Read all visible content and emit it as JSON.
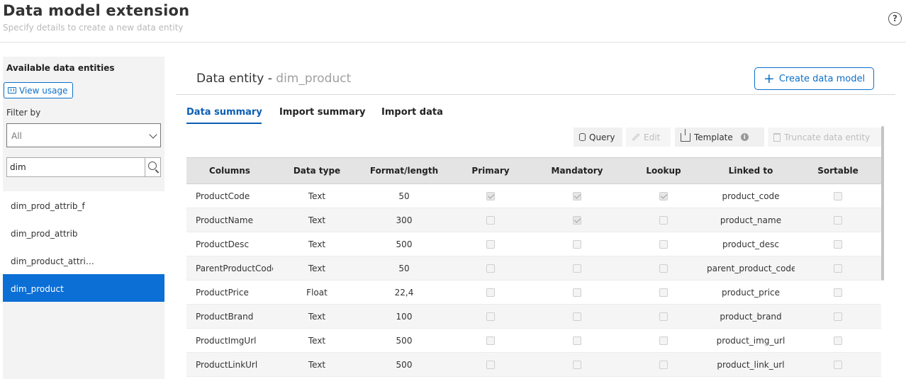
{
  "header": {
    "title": "Data model extension",
    "subtitle": "Specify details to create a new data entity",
    "help_glyph": "?"
  },
  "sidebar": {
    "title": "Available data entities",
    "view_usage_label": "View usage",
    "filter_label": "Filter by",
    "filter_value": "All",
    "search_value": "dim",
    "items": [
      {
        "label": "dim_prod_attrib_f",
        "active": false
      },
      {
        "label": "dim_prod_attrib",
        "active": false
      },
      {
        "label": "dim_product_attri…",
        "active": false
      },
      {
        "label": "dim_product",
        "active": true
      }
    ]
  },
  "main": {
    "heading_prefix": "Data entity - ",
    "entity_name": "dim_product",
    "create_button_label": "Create data model",
    "tabs": [
      {
        "label": "Data summary",
        "active": true
      },
      {
        "label": "Import summary",
        "active": false
      },
      {
        "label": "Import data",
        "active": false
      }
    ],
    "toolbar": {
      "query_label": "Query",
      "edit_label": "Edit",
      "template_label": "Template",
      "truncate_label": "Truncate data entity",
      "info_glyph": "i"
    },
    "table": {
      "columns": [
        "Columns",
        "Data type",
        "Format/length",
        "Primary",
        "Mandatory",
        "Lookup",
        "Linked to",
        "Sortable"
      ],
      "rows": [
        {
          "column": "ProductCode",
          "type": "Text",
          "format": "50",
          "primary": true,
          "mandatory": true,
          "lookup": true,
          "linked_to": "product_code",
          "sortable": false
        },
        {
          "column": "ProductName",
          "type": "Text",
          "format": "300",
          "primary": false,
          "mandatory": true,
          "lookup": false,
          "linked_to": "product_name",
          "sortable": false
        },
        {
          "column": "ProductDesc",
          "type": "Text",
          "format": "500",
          "primary": false,
          "mandatory": false,
          "lookup": false,
          "linked_to": "product_desc",
          "sortable": false
        },
        {
          "column": "ParentProductCode",
          "type": "Text",
          "format": "50",
          "primary": false,
          "mandatory": false,
          "lookup": false,
          "linked_to": "parent_product_code",
          "sortable": false
        },
        {
          "column": "ProductPrice",
          "type": "Float",
          "format": "22,4",
          "primary": false,
          "mandatory": false,
          "lookup": false,
          "linked_to": "product_price",
          "sortable": false
        },
        {
          "column": "ProductBrand",
          "type": "Text",
          "format": "100",
          "primary": false,
          "mandatory": false,
          "lookup": false,
          "linked_to": "product_brand",
          "sortable": false
        },
        {
          "column": "ProductImgUrl",
          "type": "Text",
          "format": "500",
          "primary": false,
          "mandatory": false,
          "lookup": false,
          "linked_to": "product_img_url",
          "sortable": false
        },
        {
          "column": "ProductLinkUrl",
          "type": "Text",
          "format": "500",
          "primary": false,
          "mandatory": false,
          "lookup": false,
          "linked_to": "product_link_url",
          "sortable": false
        }
      ]
    }
  },
  "colors": {
    "accent": "#0b6fc9",
    "active_item": "#0b6fd6"
  }
}
